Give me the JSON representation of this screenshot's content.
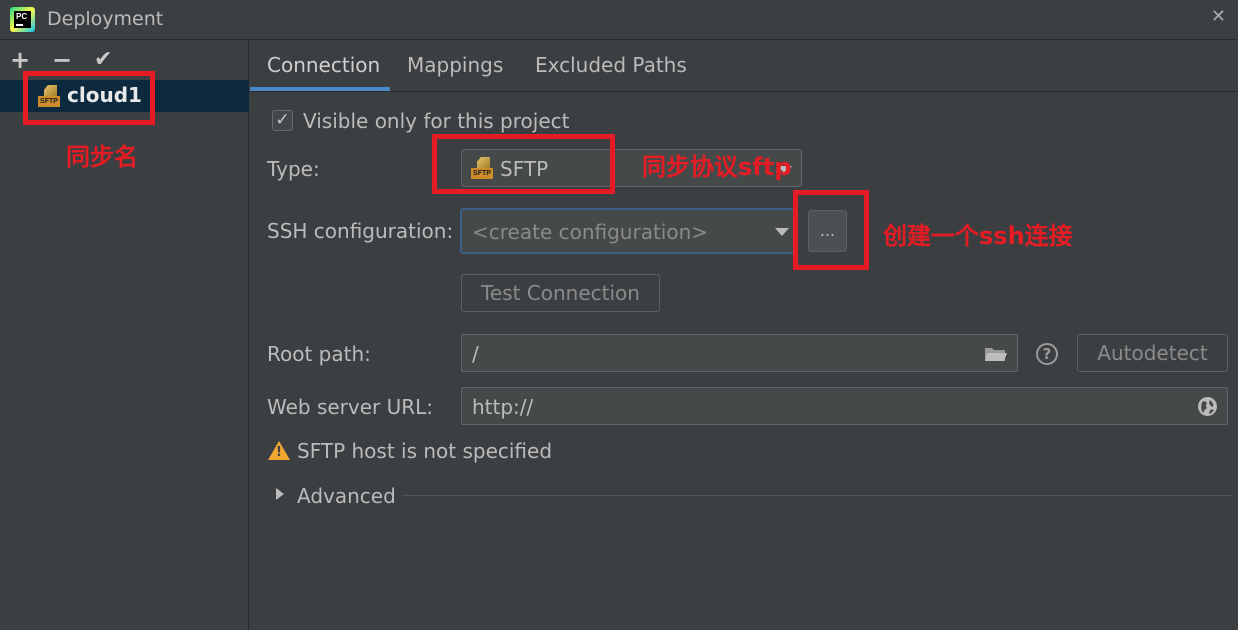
{
  "window": {
    "title": "Deployment",
    "app_icon": "pycharm-icon",
    "app_icon_text": "PC"
  },
  "sidebar": {
    "toolbar": {
      "add": "+",
      "remove": "−",
      "apply": "✔"
    },
    "servers": [
      {
        "name": "cloud1",
        "icon": "sftp-server-icon",
        "icon_label": "SFTP"
      }
    ]
  },
  "tabs": [
    {
      "label": "Connection",
      "selected": true
    },
    {
      "label": "Mappings",
      "selected": false
    },
    {
      "label": "Excluded Paths",
      "selected": false
    }
  ],
  "connection": {
    "visible_only_label": "Visible only for this project",
    "visible_only_checked": true,
    "type_label": "Type:",
    "type_value": "SFTP",
    "type_icon_label": "SFTP",
    "ssh_label": "SSH configuration:",
    "ssh_placeholder": "<create configuration>",
    "ssh_more_button": "...",
    "test_connection_button": "Test Connection",
    "root_path_label": "Root path:",
    "root_path_value": "/",
    "autodetect_button": "Autodetect",
    "help_icon_text": "?",
    "web_url_label": "Web server URL:",
    "web_url_value": "http://",
    "warning_text": "SFTP host is not specified",
    "warning_icon_text": "!",
    "advanced_label": "Advanced"
  },
  "annotations": {
    "server_name_note": "同步名",
    "type_note": "同步协议sftp",
    "ssh_note": "创建一个ssh连接"
  },
  "colors": {
    "annotation": "#e51c23",
    "accent": "#4a88c7",
    "warning": "#f0a732",
    "background": "#3c3f41"
  }
}
